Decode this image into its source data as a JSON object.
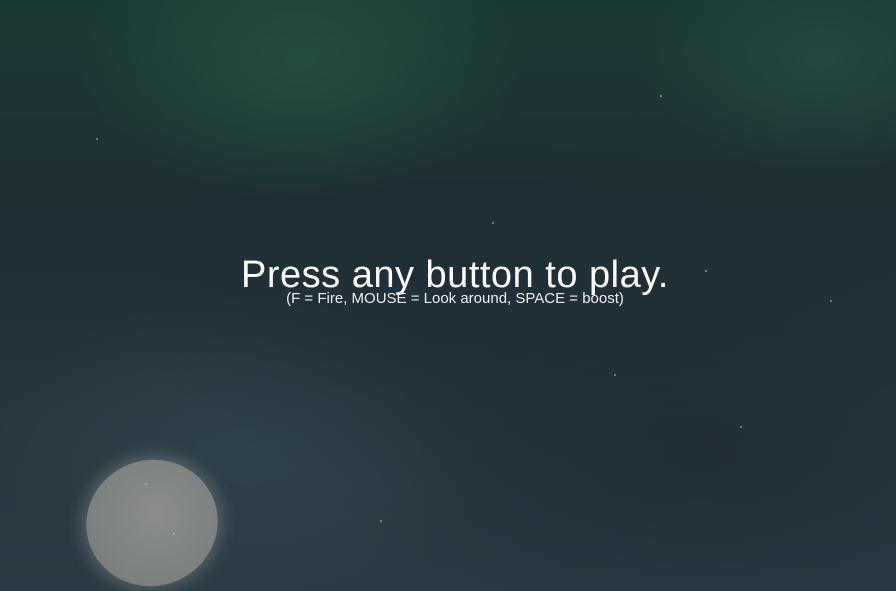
{
  "overlay": {
    "title": "Press any button to play.",
    "controls_hint": "(F = Fire, MOUSE = Look around, SPACE = boost)"
  },
  "colors": {
    "text": "#ffffff",
    "background": "#1f2c33",
    "planet": "#7e8281"
  },
  "icons": {
    "planet": "planet-sphere"
  }
}
